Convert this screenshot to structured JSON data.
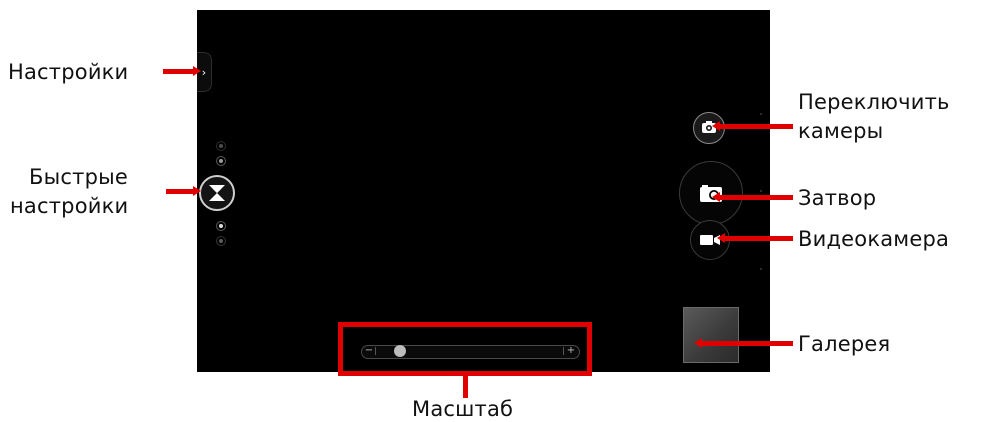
{
  "labels": {
    "settings": "Настройки",
    "quick_settings_line1": "Быстрые",
    "quick_settings_line2": "настройки",
    "switch_camera_line1": "Переключить",
    "switch_camera_line2": "камеры",
    "shutter": "Затвор",
    "video_camera": "Видеокамера",
    "gallery": "Галерея",
    "zoom": "Масштаб"
  },
  "controls": {
    "settings_tab_glyph": "›",
    "zoom_minus": "−",
    "zoom_plus": "+",
    "zoom_level": 0.1
  },
  "icons": {
    "settings": "chevron-right-icon",
    "quick_settings": "aperture-icon",
    "switch_camera": "camera-switch-icon",
    "shutter": "camera-icon",
    "video": "video-camera-icon"
  },
  "colors": {
    "callout": "#e00000",
    "viewfinder": "#000000"
  }
}
